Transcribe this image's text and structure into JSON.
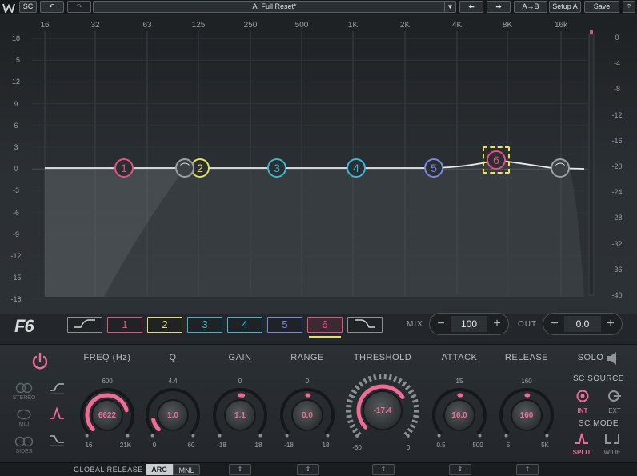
{
  "toolbar": {
    "sc": "SC",
    "undo_icon": "undo-icon",
    "redo_icon": "redo-icon",
    "preset": "A: Full Reset*",
    "preset_dropdown": "▼",
    "prev": "⬅",
    "next": "➡",
    "ab": "A→B",
    "setup": "Setup A",
    "save": "Save"
  },
  "graph": {
    "freq_labels": [
      "16",
      "32",
      "63",
      "125",
      "250",
      "500",
      "1K",
      "2K",
      "4K",
      "8K",
      "16k"
    ],
    "db_left": [
      "18",
      "15",
      "12",
      "9",
      "6",
      "3",
      "0",
      "-3",
      "-6",
      "-9",
      "-12",
      "-15",
      "-18"
    ],
    "db_right": [
      "0",
      "-4",
      "-8",
      "-12",
      "-16",
      "-20",
      "-24",
      "-28",
      "-32",
      "-36",
      "-40"
    ],
    "nodes": [
      {
        "label": "1",
        "color": "#e8507e"
      },
      {
        "label": "2",
        "color": "#e3df5a"
      },
      {
        "label": "3",
        "color": "#3fb6c8"
      },
      {
        "label": "4",
        "color": "#3fb6d8"
      },
      {
        "label": "5",
        "color": "#7b86e0"
      },
      {
        "label": "6",
        "color": "#e8507e"
      }
    ],
    "hp_icon": "⌒",
    "lp_icon": "⌒"
  },
  "bands": {
    "hp_label": "",
    "lp_label": "",
    "buttons": [
      {
        "label": "1",
        "color": "#e8507e"
      },
      {
        "label": "2",
        "color": "#e3df5a"
      },
      {
        "label": "3",
        "color": "#3fb6c8"
      },
      {
        "label": "4",
        "color": "#3fb6d8"
      },
      {
        "label": "5",
        "color": "#7b86e0"
      },
      {
        "label": "6",
        "color": "#e8507e"
      }
    ]
  },
  "logo": "F6",
  "mix": {
    "label": "MIX",
    "value": "100",
    "minus": "−",
    "plus": "+"
  },
  "out": {
    "label": "OUT",
    "value": "0.0",
    "minus": "−",
    "plus": "+"
  },
  "controls": {
    "freq": {
      "title": "FREQ (Hz)",
      "top": "600",
      "min": "16",
      "max": "21K",
      "value": "6622",
      "level": 0.78
    },
    "q": {
      "title": "Q",
      "top": "4.4",
      "min": "0",
      "max": "60",
      "value": "1.0",
      "level": 0.12
    },
    "gain": {
      "title": "GAIN",
      "top": "0",
      "min": "-18",
      "max": "18",
      "value": "1.1",
      "level": 0.53
    },
    "range": {
      "title": "RANGE",
      "top": "0",
      "min": "-18",
      "max": "18",
      "value": "0.0",
      "level": 0.5
    },
    "threshold": {
      "title": "THRESHOLD",
      "min": "-60",
      "max": "0",
      "value": "-17.4",
      "level": 0.71
    },
    "attack": {
      "title": "ATTACK",
      "top": "15",
      "min": "0.5",
      "max": "500",
      "value": "16.0",
      "level": 0.5
    },
    "release": {
      "title": "RELEASE",
      "top": "160",
      "min": "5",
      "max": "5K",
      "value": "160",
      "level": 0.5
    }
  },
  "side": {
    "stereo": "STEREO",
    "mid": "MID",
    "sides": "SIDES"
  },
  "solo": "SOLO",
  "sc_source": {
    "title": "SC SOURCE",
    "int": "INT",
    "ext": "EXT"
  },
  "sc_mode": {
    "title": "SC MODE",
    "split": "SPLIT",
    "wide": "WIDE"
  },
  "footer": {
    "global_release": "GLOBAL RELEASE",
    "arc": "ARC",
    "mnl": "MNL",
    "stepper": "⇕"
  },
  "colors": {
    "accent": "#f06c95",
    "yellow": "#f0e24a"
  }
}
